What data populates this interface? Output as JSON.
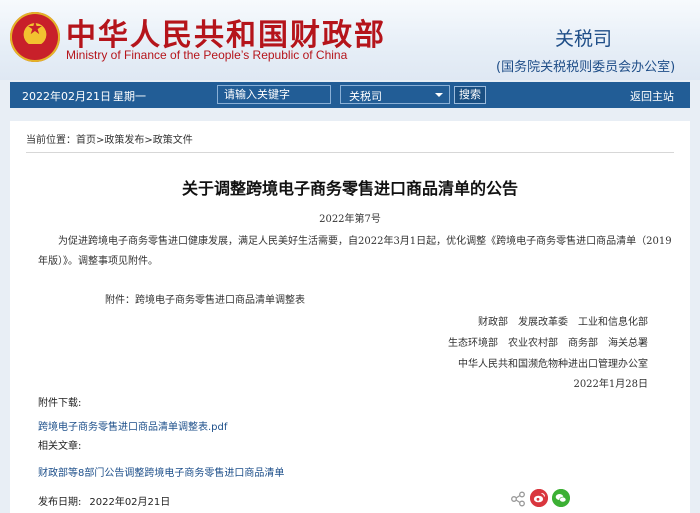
{
  "header": {
    "title": "中华人民共和国财政部",
    "subtitle": "Ministry of Finance of the People’s Republic of China",
    "dept_title": "关税司",
    "dept_subtitle": "(国务院关税税则委员会办公室)"
  },
  "navbar": {
    "date": "2022年02月21日",
    "weekday": "星期一",
    "search_placeholder": "请输入关键字",
    "select_value": "关税司",
    "search_button": "搜索",
    "home_link": "返回主站"
  },
  "breadcrumb": {
    "prefix": "当前位置：",
    "items": [
      "首页",
      "政策发布",
      "政策文件"
    ],
    "separator": ">"
  },
  "article": {
    "title": "关于调整跨境电子商务零售进口商品清单的公告",
    "doc_number": "2022年第7号",
    "body": "为促进跨境电子商务零售进口健康发展，满足人民美好生活需要，自2022年3月1日起，优化调整《跨境电子商务零售进口商品清单（2019年版）》。调整事项见附件。",
    "attachment_note": "附件：跨境电子商务零售进口商品清单调整表",
    "signatures": [
      "财政部　发展改革委　工业和信息化部",
      "生态环境部　农业农村部　商务部　海关总署",
      "中华人民共和国濒危物种进出口管理办公室",
      "2022年1月28日"
    ]
  },
  "downloads": {
    "label": "附件下载:",
    "link": "跨境电子商务零售进口商品清单调整表.pdf"
  },
  "related": {
    "label": "相关文章:",
    "link": "财政部等8部门公告调整跨境电子商务零售进口商品清单"
  },
  "publish": {
    "label": "发布日期:",
    "date": "2022年02月21日"
  },
  "icons": {
    "share": "share-icon",
    "weibo": "weibo-icon",
    "wechat": "wechat-icon"
  },
  "colors": {
    "brand_red": "#b5141b",
    "nav_blue": "#225d96",
    "link_blue": "#1d4f8a"
  }
}
